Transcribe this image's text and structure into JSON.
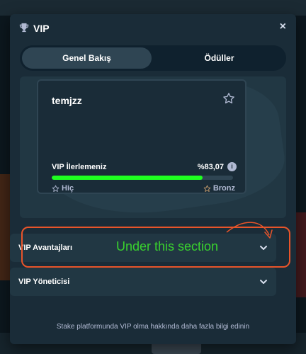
{
  "modal": {
    "title": "VIP",
    "close_glyph": "×"
  },
  "tabs": [
    {
      "label": "Genel Bakış",
      "active": true
    },
    {
      "label": "Ödüller",
      "active": false
    }
  ],
  "card": {
    "username": "temjzz",
    "progress_label": "VIP İlerlemeniz",
    "progress_text": "%83,07",
    "progress_fraction": 0.8307,
    "from_tier": "Hiç",
    "to_tier": "Bronz"
  },
  "accordions": [
    {
      "label": "VIP Avantajları"
    },
    {
      "label": "VIP Yöneticisi"
    }
  ],
  "annotation": {
    "text": "Under this section"
  },
  "footer": {
    "link_text": "Stake platformunda VIP olma hakkında daha fazla bilgi edinin"
  },
  "icons": {
    "header": "trophy-icon",
    "close": "close-icon",
    "favorite": "star-icon",
    "info": "info-icon",
    "chevron": "chevron-down-icon"
  },
  "colors": {
    "progress_fill": "#1fff20",
    "annotation_border": "#e8542a",
    "annotation_text": "#39d22e"
  }
}
